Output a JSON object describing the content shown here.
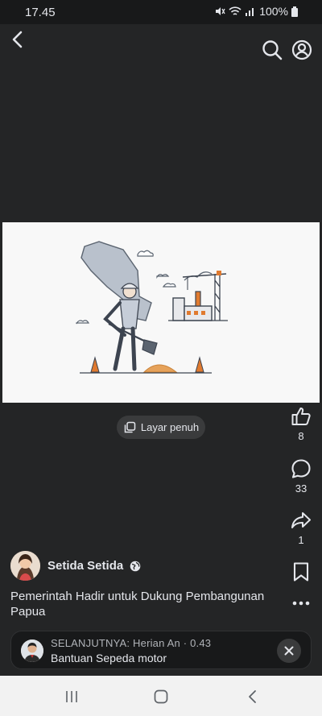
{
  "status_bar": {
    "time": "17.45",
    "battery": "100%"
  },
  "topbar": {
    "back_icon": "chevron-left-icon",
    "search_icon": "search-icon",
    "profile_icon": "user-circle-icon"
  },
  "fullscreen": {
    "label": "Layar penuh",
    "icon": "fullscreen-icon"
  },
  "actions": {
    "like_count": "8",
    "comment_count": "33",
    "share_count": "1"
  },
  "post": {
    "author": "Setida Setida",
    "audience_icon": "globe-icon",
    "caption": "Pemerintah Hadir untuk Dukung Pembangunan Papua"
  },
  "next_up": {
    "label": "SELANJUTNYA: Herian An · 0.43",
    "title": "Bantuan Sepeda motor"
  }
}
